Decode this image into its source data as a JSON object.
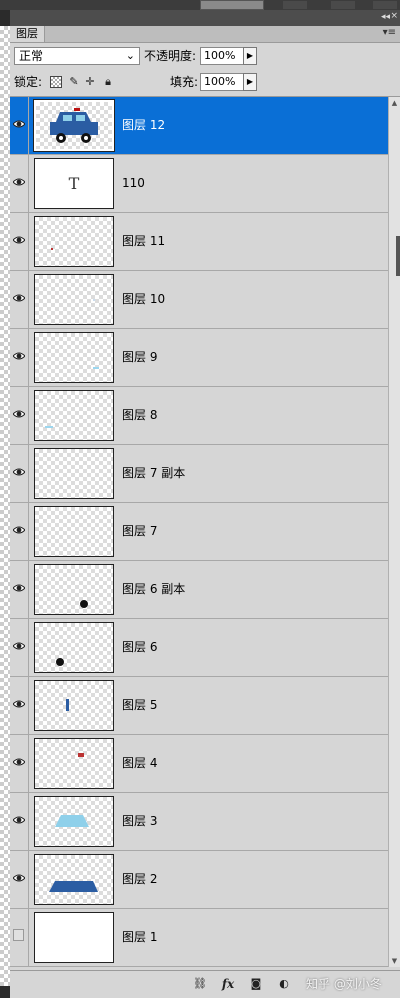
{
  "panel": {
    "tab_label": "图层",
    "menu_icon": "▾≡",
    "collapse_icon": "◂◂",
    "close_icon": "×"
  },
  "blend": {
    "mode": "正常",
    "opacity_label": "不透明度:",
    "opacity_value": "100%"
  },
  "lock": {
    "label": "锁定:",
    "fill_label": "填充:",
    "fill_value": "100%"
  },
  "layers": [
    {
      "name": "图层 12",
      "visible": true,
      "selected": true,
      "thumb": "car"
    },
    {
      "name": "110",
      "visible": true,
      "selected": false,
      "thumb": "text"
    },
    {
      "name": "图层 11",
      "visible": true,
      "selected": false,
      "thumb": "dot-red"
    },
    {
      "name": "图层 10",
      "visible": true,
      "selected": false,
      "thumb": "speck"
    },
    {
      "name": "图层 9",
      "visible": true,
      "selected": false,
      "thumb": "light-blue-speck"
    },
    {
      "name": "图层 8",
      "visible": true,
      "selected": false,
      "thumb": "light-blue-speck-left"
    },
    {
      "name": "图层 7 副本",
      "visible": true,
      "selected": false,
      "thumb": "empty"
    },
    {
      "name": "图层 7",
      "visible": true,
      "selected": false,
      "thumb": "empty"
    },
    {
      "name": "图层 6 副本",
      "visible": true,
      "selected": false,
      "thumb": "wheel-right"
    },
    {
      "name": "图层 6",
      "visible": true,
      "selected": false,
      "thumb": "wheel-left"
    },
    {
      "name": "图层 5",
      "visible": true,
      "selected": false,
      "thumb": "blue-bar"
    },
    {
      "name": "图层 4",
      "visible": true,
      "selected": false,
      "thumb": "red-light"
    },
    {
      "name": "图层 3",
      "visible": true,
      "selected": false,
      "thumb": "window"
    },
    {
      "name": "图层 2",
      "visible": true,
      "selected": false,
      "thumb": "car-body"
    },
    {
      "name": "图层 1",
      "visible": false,
      "selected": false,
      "thumb": "white"
    }
  ],
  "bottom": {
    "watermark": "知乎 @刘小冬"
  },
  "colors": {
    "selection": "#0a6fd6",
    "panel_bg": "#d6d6d6",
    "car_blue": "#2b5da3",
    "window_blue": "#8fd0ea"
  }
}
